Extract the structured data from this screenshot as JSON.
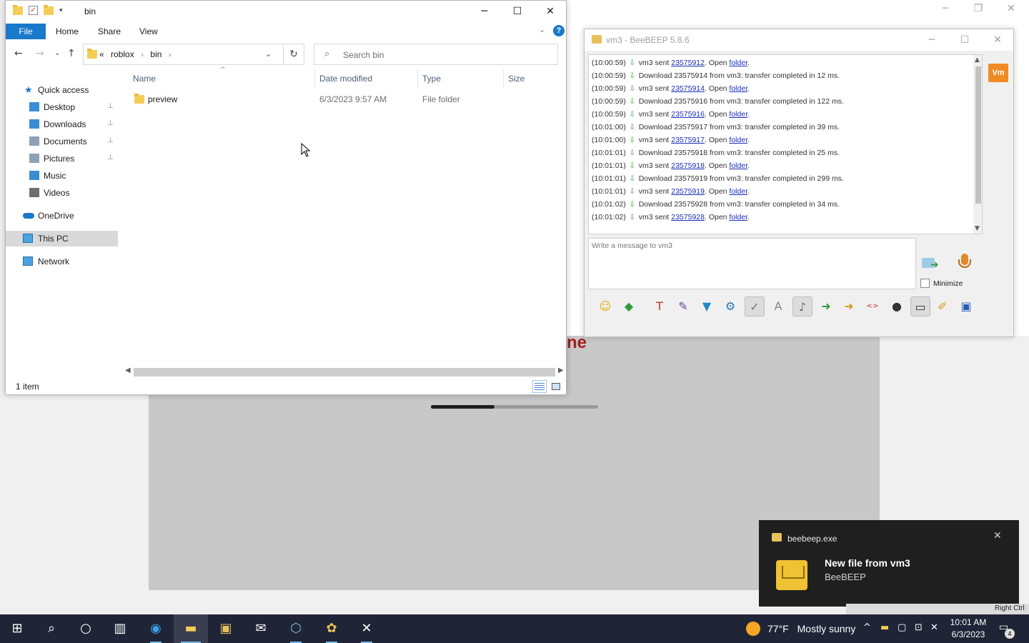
{
  "background_app": {
    "red_text": "ne",
    "progress_fraction": 0.38
  },
  "explorer": {
    "title": "bin",
    "ribbon": {
      "file": "File",
      "home": "Home",
      "share": "Share",
      "view": "View",
      "help": "?"
    },
    "address": {
      "overflow": "«",
      "crumbs": [
        "roblox",
        "bin"
      ]
    },
    "search_placeholder": "Search bin",
    "sidebar": {
      "quick_access": "Quick access",
      "items": [
        {
          "label": "Desktop",
          "icon": "desktop-icon",
          "pinned": true
        },
        {
          "label": "Downloads",
          "icon": "downloads-icon",
          "pinned": true
        },
        {
          "label": "Documents",
          "icon": "documents-icon",
          "pinned": true
        },
        {
          "label": "Pictures",
          "icon": "pictures-icon",
          "pinned": true
        },
        {
          "label": "Music",
          "icon": "music-icon",
          "pinned": false
        },
        {
          "label": "Videos",
          "icon": "videos-icon",
          "pinned": false
        }
      ],
      "onedrive": "OneDrive",
      "this_pc": "This PC",
      "network": "Network"
    },
    "columns": {
      "name": "Name",
      "date": "Date modified",
      "type": "Type",
      "size": "Size"
    },
    "rows": [
      {
        "name": "preview",
        "date": "6/3/2023 9:57 AM",
        "type": "File folder",
        "size": ""
      }
    ],
    "status": "1 item"
  },
  "beebeep": {
    "title": "vm3 - BeeBEEP 5.8.6",
    "user_badge": "Vm",
    "messages": [
      {
        "ts": "(10:00:59)",
        "kind": "sent",
        "user": "vm3",
        "file": "23575912",
        "open": "Open",
        "folder": "folder"
      },
      {
        "ts": "(10:00:59)",
        "kind": "download",
        "text": "Download 23575914 from vm3: transfer completed in 12 ms."
      },
      {
        "ts": "(10:00:59)",
        "kind": "sent",
        "user": "vm3",
        "file": "23575914",
        "open": "Open",
        "folder": "folder"
      },
      {
        "ts": "(10:00:59)",
        "kind": "download",
        "text": "Download 23575916 from vm3: transfer completed in 122 ms."
      },
      {
        "ts": "(10:00:59)",
        "kind": "sent",
        "user": "vm3",
        "file": "23575916",
        "open": "Open",
        "folder": "folder"
      },
      {
        "ts": "(10:01:00)",
        "kind": "download",
        "text": "Download 23575917 from vm3: transfer completed in 39 ms."
      },
      {
        "ts": "(10:01:00)",
        "kind": "sent",
        "user": "vm3",
        "file": "23575917",
        "open": "Open",
        "folder": "folder"
      },
      {
        "ts": "(10:01:01)",
        "kind": "download",
        "text": "Download 23575918 from vm3: transfer completed in 25 ms."
      },
      {
        "ts": "(10:01:01)",
        "kind": "sent",
        "user": "vm3",
        "file": "23575918",
        "open": "Open",
        "folder": "folder"
      },
      {
        "ts": "(10:01:01)",
        "kind": "download",
        "text": "Download 23575919 from vm3: transfer completed in 299 ms."
      },
      {
        "ts": "(10:01:01)",
        "kind": "sent",
        "user": "vm3",
        "file": "23575919",
        "open": "Open",
        "folder": "folder"
      },
      {
        "ts": "(10:01:02)",
        "kind": "download",
        "text": "Download 23575928 from vm3: transfer completed in 34 ms."
      },
      {
        "ts": "(10:01:02)",
        "kind": "sent",
        "user": "vm3",
        "file": "23575928",
        "open": "Open",
        "folder": "folder"
      }
    ],
    "message_placeholder": "Write a message to vm3",
    "minimize_label": "Minimize",
    "toolbar": [
      {
        "icon": "emoji-icon",
        "glyph": "☺",
        "color": "#e6a800",
        "pressed": false
      },
      {
        "icon": "buzz-icon",
        "glyph": "◆",
        "color": "#2e9c3a",
        "pressed": false
      },
      {
        "icon": "font-icon",
        "glyph": "T",
        "color": "#b03a2e",
        "pressed": false
      },
      {
        "icon": "font-color-icon",
        "glyph": "✎",
        "color": "#6b3fa0",
        "pressed": false
      },
      {
        "icon": "filter-icon",
        "glyph": "▼",
        "color": "#1e88c8",
        "pressed": false
      },
      {
        "icon": "settings-icon",
        "glyph": "⚙",
        "color": "#2a7ab8",
        "pressed": false
      },
      {
        "icon": "enter-send-icon",
        "glyph": "✓",
        "color": "#777777",
        "pressed": true
      },
      {
        "icon": "spellcheck-icon",
        "glyph": "A",
        "color": "#888888",
        "pressed": false
      },
      {
        "icon": "sound-icon",
        "glyph": "♪",
        "color": "#666666",
        "pressed": true
      },
      {
        "icon": "send-file-icon",
        "glyph": "➜",
        "color": "#2e9c3a",
        "pressed": false
      },
      {
        "icon": "send-folder-icon",
        "glyph": "➜",
        "color": "#d89b1c",
        "pressed": false
      },
      {
        "icon": "html-icon",
        "glyph": "<>",
        "color": "#c0392b",
        "pressed": false
      },
      {
        "icon": "screenshot-icon",
        "glyph": "●",
        "color": "#333333",
        "pressed": false
      },
      {
        "icon": "terminal-icon",
        "glyph": "▭",
        "color": "#333333",
        "pressed": true
      },
      {
        "icon": "notes-icon",
        "glyph": "✐",
        "color": "#d89b1c",
        "pressed": false
      },
      {
        "icon": "save-chat-icon",
        "glyph": "▣",
        "color": "#2a5ab8",
        "pressed": false
      }
    ]
  },
  "toast": {
    "app": "beebeep.exe",
    "title": "New file from vm3",
    "subtitle": "BeeBEEP"
  },
  "tray_strip_label": "Right Ctrl",
  "taskbar": {
    "weather_temp": "77°F",
    "weather_text": "Mostly sunny",
    "time": "10:01 AM",
    "date": "6/3/2023",
    "notification_count": "4"
  }
}
